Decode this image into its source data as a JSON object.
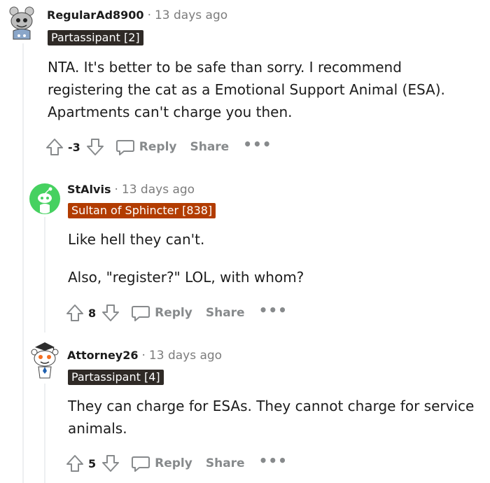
{
  "comments": [
    {
      "username": "RegularAd8900",
      "separator": "·",
      "time": "13 days ago",
      "flair": "Partassipant [2]",
      "flair_color": "#2f2a26",
      "body": [
        "NTA. It's better to be safe than sorry. I recommend",
        "registering the cat as a Emotional Support Animal (ESA).",
        "Apartments can't charge you then."
      ],
      "score": "-3",
      "reply_label": "Reply",
      "share_label": "Share",
      "more_label": "•••"
    },
    {
      "username": "StAlvis",
      "separator": "·",
      "time": "13 days ago",
      "flair": "Sultan of Sphincter [838]",
      "flair_color": "#b23c00",
      "body": [
        "Like hell they can't.",
        "Also, \"register?\" LOL, with whom?"
      ],
      "score": "8",
      "reply_label": "Reply",
      "share_label": "Share",
      "more_label": "•••"
    },
    {
      "username": "Attorney26",
      "separator": "·",
      "time": "13 days ago",
      "flair": "Partassipant [4]",
      "flair_color": "#2f2a26",
      "body": [
        "They can charge for ESAs. They cannot charge for service",
        "animals."
      ],
      "score": "5",
      "reply_label": "Reply",
      "share_label": "Share",
      "more_label": "•••"
    }
  ],
  "icons": {
    "upvote": "arrow-up-icon",
    "downvote": "arrow-down-icon",
    "reply": "comment-bubble-icon",
    "more": "more-dots-icon"
  },
  "colors": {
    "meta_gray": "#7c7c7c",
    "action_gray": "#878a8c",
    "thread_line": "#edeff1",
    "avatar_green": "#46d160"
  }
}
